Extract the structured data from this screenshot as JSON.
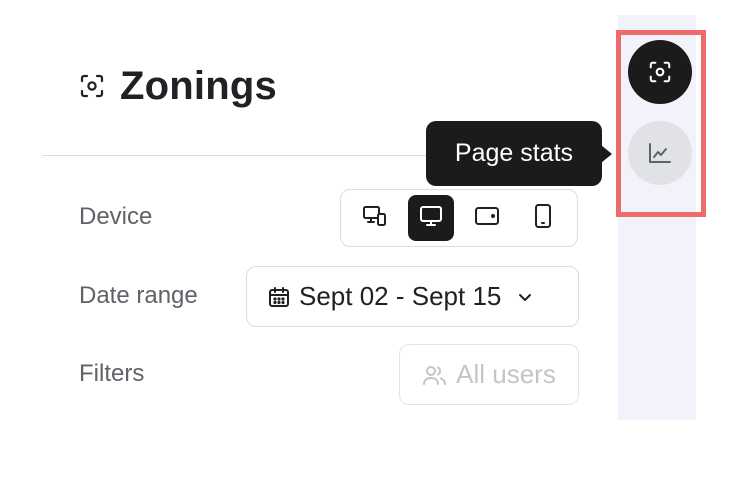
{
  "header": {
    "title": "Zonings",
    "title_icon": "scan-focus-icon"
  },
  "controls": {
    "device": {
      "label": "Device",
      "options": [
        {
          "name": "all-devices",
          "icon": "devices-icon",
          "active": false
        },
        {
          "name": "desktop",
          "icon": "desktop-icon",
          "active": true
        },
        {
          "name": "tablet",
          "icon": "tablet-icon",
          "active": false
        },
        {
          "name": "mobile",
          "icon": "mobile-icon",
          "active": false
        }
      ]
    },
    "date_range": {
      "label": "Date range",
      "value": "Sept 02 - Sept 15",
      "icon": "calendar-icon"
    },
    "filters": {
      "label": "Filters",
      "value": "All users",
      "icon": "users-icon"
    }
  },
  "sidebar": {
    "buttons": [
      {
        "name": "zonings",
        "icon": "scan-focus-icon",
        "active": true
      },
      {
        "name": "page-stats",
        "icon": "line-chart-icon",
        "active": false
      }
    ]
  },
  "tooltip": {
    "text": "Page stats"
  },
  "colors": {
    "dark": "#1b1b1b",
    "highlight": "#ee6b6b",
    "sidebar_bg": "#f2f3fa",
    "muted_text": "#5f6368"
  }
}
